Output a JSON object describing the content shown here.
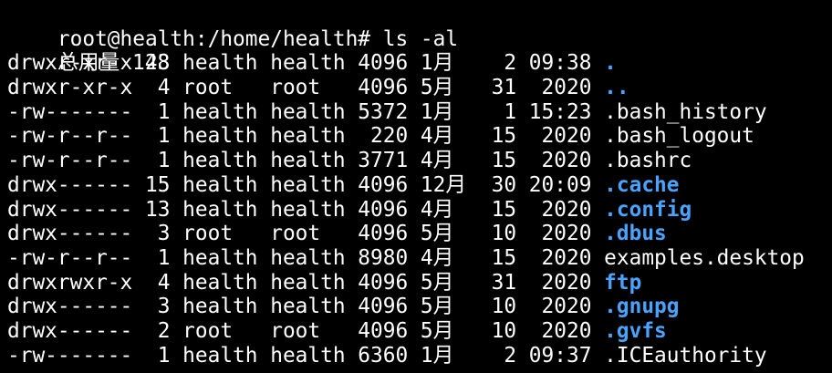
{
  "window": {
    "background": "#000000",
    "foreground": "#ffffff",
    "directory_color": "#4aa3ff"
  },
  "prompt": {
    "text": "root@health:/home/health# ls -al"
  },
  "summary": {
    "text": "总用量 148"
  },
  "listing": [
    {
      "prefix": "drwxr-xr-x 23 health health 4096 1月    2 09:38 ",
      "name": ".",
      "is_dir": true
    },
    {
      "prefix": "drwxr-xr-x  4 root   root   4096 5月   31  2020 ",
      "name": "..",
      "is_dir": true
    },
    {
      "prefix": "-rw-------  1 health health 5372 1月    1 15:23 ",
      "name": ".bash_history",
      "is_dir": false
    },
    {
      "prefix": "-rw-r--r--  1 health health  220 4月   15  2020 ",
      "name": ".bash_logout",
      "is_dir": false
    },
    {
      "prefix": "-rw-r--r--  1 health health 3771 4月   15  2020 ",
      "name": ".bashrc",
      "is_dir": false
    },
    {
      "prefix": "drwx------ 15 health health 4096 12月  30 20:09 ",
      "name": ".cache",
      "is_dir": true
    },
    {
      "prefix": "drwx------ 13 health health 4096 4月   15  2020 ",
      "name": ".config",
      "is_dir": true
    },
    {
      "prefix": "drwx------  3 root   root   4096 5月   10  2020 ",
      "name": ".dbus",
      "is_dir": true
    },
    {
      "prefix": "-rw-r--r--  1 health health 8980 4月   15  2020 ",
      "name": "examples.desktop",
      "is_dir": false
    },
    {
      "prefix": "drwxrwxr-x  4 health health 4096 5月   31  2020 ",
      "name": "ftp",
      "is_dir": true
    },
    {
      "prefix": "drwx------  3 health health 4096 5月   10  2020 ",
      "name": ".gnupg",
      "is_dir": true
    },
    {
      "prefix": "drwx------  2 root   root   4096 5月   10  2020 ",
      "name": ".gvfs",
      "is_dir": true
    },
    {
      "prefix": "-rw-------  1 health health 6360 1月    2 09:37 ",
      "name": ".ICEauthority",
      "is_dir": false
    }
  ]
}
